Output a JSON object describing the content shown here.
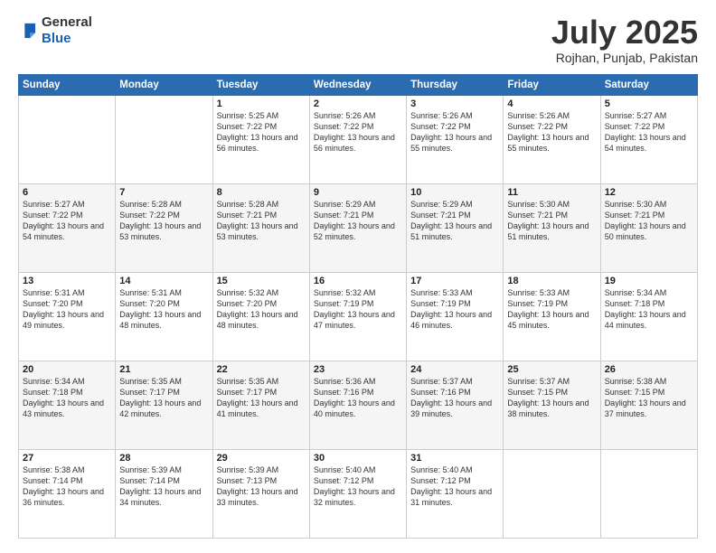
{
  "logo": {
    "general": "General",
    "blue": "Blue"
  },
  "header": {
    "month": "July 2025",
    "location": "Rojhan, Punjab, Pakistan"
  },
  "weekdays": [
    "Sunday",
    "Monday",
    "Tuesday",
    "Wednesday",
    "Thursday",
    "Friday",
    "Saturday"
  ],
  "weeks": [
    [
      {
        "day": "",
        "sunrise": "",
        "sunset": "",
        "daylight": ""
      },
      {
        "day": "",
        "sunrise": "",
        "sunset": "",
        "daylight": ""
      },
      {
        "day": "1",
        "sunrise": "Sunrise: 5:25 AM",
        "sunset": "Sunset: 7:22 PM",
        "daylight": "Daylight: 13 hours and 56 minutes."
      },
      {
        "day": "2",
        "sunrise": "Sunrise: 5:26 AM",
        "sunset": "Sunset: 7:22 PM",
        "daylight": "Daylight: 13 hours and 56 minutes."
      },
      {
        "day": "3",
        "sunrise": "Sunrise: 5:26 AM",
        "sunset": "Sunset: 7:22 PM",
        "daylight": "Daylight: 13 hours and 55 minutes."
      },
      {
        "day": "4",
        "sunrise": "Sunrise: 5:26 AM",
        "sunset": "Sunset: 7:22 PM",
        "daylight": "Daylight: 13 hours and 55 minutes."
      },
      {
        "day": "5",
        "sunrise": "Sunrise: 5:27 AM",
        "sunset": "Sunset: 7:22 PM",
        "daylight": "Daylight: 13 hours and 54 minutes."
      }
    ],
    [
      {
        "day": "6",
        "sunrise": "Sunrise: 5:27 AM",
        "sunset": "Sunset: 7:22 PM",
        "daylight": "Daylight: 13 hours and 54 minutes."
      },
      {
        "day": "7",
        "sunrise": "Sunrise: 5:28 AM",
        "sunset": "Sunset: 7:22 PM",
        "daylight": "Daylight: 13 hours and 53 minutes."
      },
      {
        "day": "8",
        "sunrise": "Sunrise: 5:28 AM",
        "sunset": "Sunset: 7:21 PM",
        "daylight": "Daylight: 13 hours and 53 minutes."
      },
      {
        "day": "9",
        "sunrise": "Sunrise: 5:29 AM",
        "sunset": "Sunset: 7:21 PM",
        "daylight": "Daylight: 13 hours and 52 minutes."
      },
      {
        "day": "10",
        "sunrise": "Sunrise: 5:29 AM",
        "sunset": "Sunset: 7:21 PM",
        "daylight": "Daylight: 13 hours and 51 minutes."
      },
      {
        "day": "11",
        "sunrise": "Sunrise: 5:30 AM",
        "sunset": "Sunset: 7:21 PM",
        "daylight": "Daylight: 13 hours and 51 minutes."
      },
      {
        "day": "12",
        "sunrise": "Sunrise: 5:30 AM",
        "sunset": "Sunset: 7:21 PM",
        "daylight": "Daylight: 13 hours and 50 minutes."
      }
    ],
    [
      {
        "day": "13",
        "sunrise": "Sunrise: 5:31 AM",
        "sunset": "Sunset: 7:20 PM",
        "daylight": "Daylight: 13 hours and 49 minutes."
      },
      {
        "day": "14",
        "sunrise": "Sunrise: 5:31 AM",
        "sunset": "Sunset: 7:20 PM",
        "daylight": "Daylight: 13 hours and 48 minutes."
      },
      {
        "day": "15",
        "sunrise": "Sunrise: 5:32 AM",
        "sunset": "Sunset: 7:20 PM",
        "daylight": "Daylight: 13 hours and 48 minutes."
      },
      {
        "day": "16",
        "sunrise": "Sunrise: 5:32 AM",
        "sunset": "Sunset: 7:19 PM",
        "daylight": "Daylight: 13 hours and 47 minutes."
      },
      {
        "day": "17",
        "sunrise": "Sunrise: 5:33 AM",
        "sunset": "Sunset: 7:19 PM",
        "daylight": "Daylight: 13 hours and 46 minutes."
      },
      {
        "day": "18",
        "sunrise": "Sunrise: 5:33 AM",
        "sunset": "Sunset: 7:19 PM",
        "daylight": "Daylight: 13 hours and 45 minutes."
      },
      {
        "day": "19",
        "sunrise": "Sunrise: 5:34 AM",
        "sunset": "Sunset: 7:18 PM",
        "daylight": "Daylight: 13 hours and 44 minutes."
      }
    ],
    [
      {
        "day": "20",
        "sunrise": "Sunrise: 5:34 AM",
        "sunset": "Sunset: 7:18 PM",
        "daylight": "Daylight: 13 hours and 43 minutes."
      },
      {
        "day": "21",
        "sunrise": "Sunrise: 5:35 AM",
        "sunset": "Sunset: 7:17 PM",
        "daylight": "Daylight: 13 hours and 42 minutes."
      },
      {
        "day": "22",
        "sunrise": "Sunrise: 5:35 AM",
        "sunset": "Sunset: 7:17 PM",
        "daylight": "Daylight: 13 hours and 41 minutes."
      },
      {
        "day": "23",
        "sunrise": "Sunrise: 5:36 AM",
        "sunset": "Sunset: 7:16 PM",
        "daylight": "Daylight: 13 hours and 40 minutes."
      },
      {
        "day": "24",
        "sunrise": "Sunrise: 5:37 AM",
        "sunset": "Sunset: 7:16 PM",
        "daylight": "Daylight: 13 hours and 39 minutes."
      },
      {
        "day": "25",
        "sunrise": "Sunrise: 5:37 AM",
        "sunset": "Sunset: 7:15 PM",
        "daylight": "Daylight: 13 hours and 38 minutes."
      },
      {
        "day": "26",
        "sunrise": "Sunrise: 5:38 AM",
        "sunset": "Sunset: 7:15 PM",
        "daylight": "Daylight: 13 hours and 37 minutes."
      }
    ],
    [
      {
        "day": "27",
        "sunrise": "Sunrise: 5:38 AM",
        "sunset": "Sunset: 7:14 PM",
        "daylight": "Daylight: 13 hours and 36 minutes."
      },
      {
        "day": "28",
        "sunrise": "Sunrise: 5:39 AM",
        "sunset": "Sunset: 7:14 PM",
        "daylight": "Daylight: 13 hours and 34 minutes."
      },
      {
        "day": "29",
        "sunrise": "Sunrise: 5:39 AM",
        "sunset": "Sunset: 7:13 PM",
        "daylight": "Daylight: 13 hours and 33 minutes."
      },
      {
        "day": "30",
        "sunrise": "Sunrise: 5:40 AM",
        "sunset": "Sunset: 7:12 PM",
        "daylight": "Daylight: 13 hours and 32 minutes."
      },
      {
        "day": "31",
        "sunrise": "Sunrise: 5:40 AM",
        "sunset": "Sunset: 7:12 PM",
        "daylight": "Daylight: 13 hours and 31 minutes."
      },
      {
        "day": "",
        "sunrise": "",
        "sunset": "",
        "daylight": ""
      },
      {
        "day": "",
        "sunrise": "",
        "sunset": "",
        "daylight": ""
      }
    ]
  ]
}
